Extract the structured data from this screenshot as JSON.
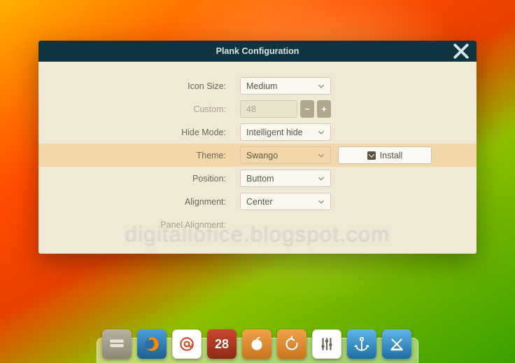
{
  "window": {
    "title": "Plank Configuration"
  },
  "form": {
    "icon_size": {
      "label": "Icon Size:",
      "value": "Medium"
    },
    "custom": {
      "label": "Custom:",
      "value": "48"
    },
    "hide_mode": {
      "label": "Hide Mode:",
      "value": "Intelligent hide"
    },
    "theme": {
      "label": "Theme:",
      "value": "Swango",
      "install": "Install"
    },
    "position": {
      "label": "Position:",
      "value": "Buttom"
    },
    "alignment": {
      "label": "Alignment:",
      "value": "Center"
    },
    "panel_alignment": {
      "label": "Panel Alignment:"
    }
  },
  "watermark": "digitallofice.blogspot.com",
  "dock": {
    "calendar_day": "28"
  }
}
